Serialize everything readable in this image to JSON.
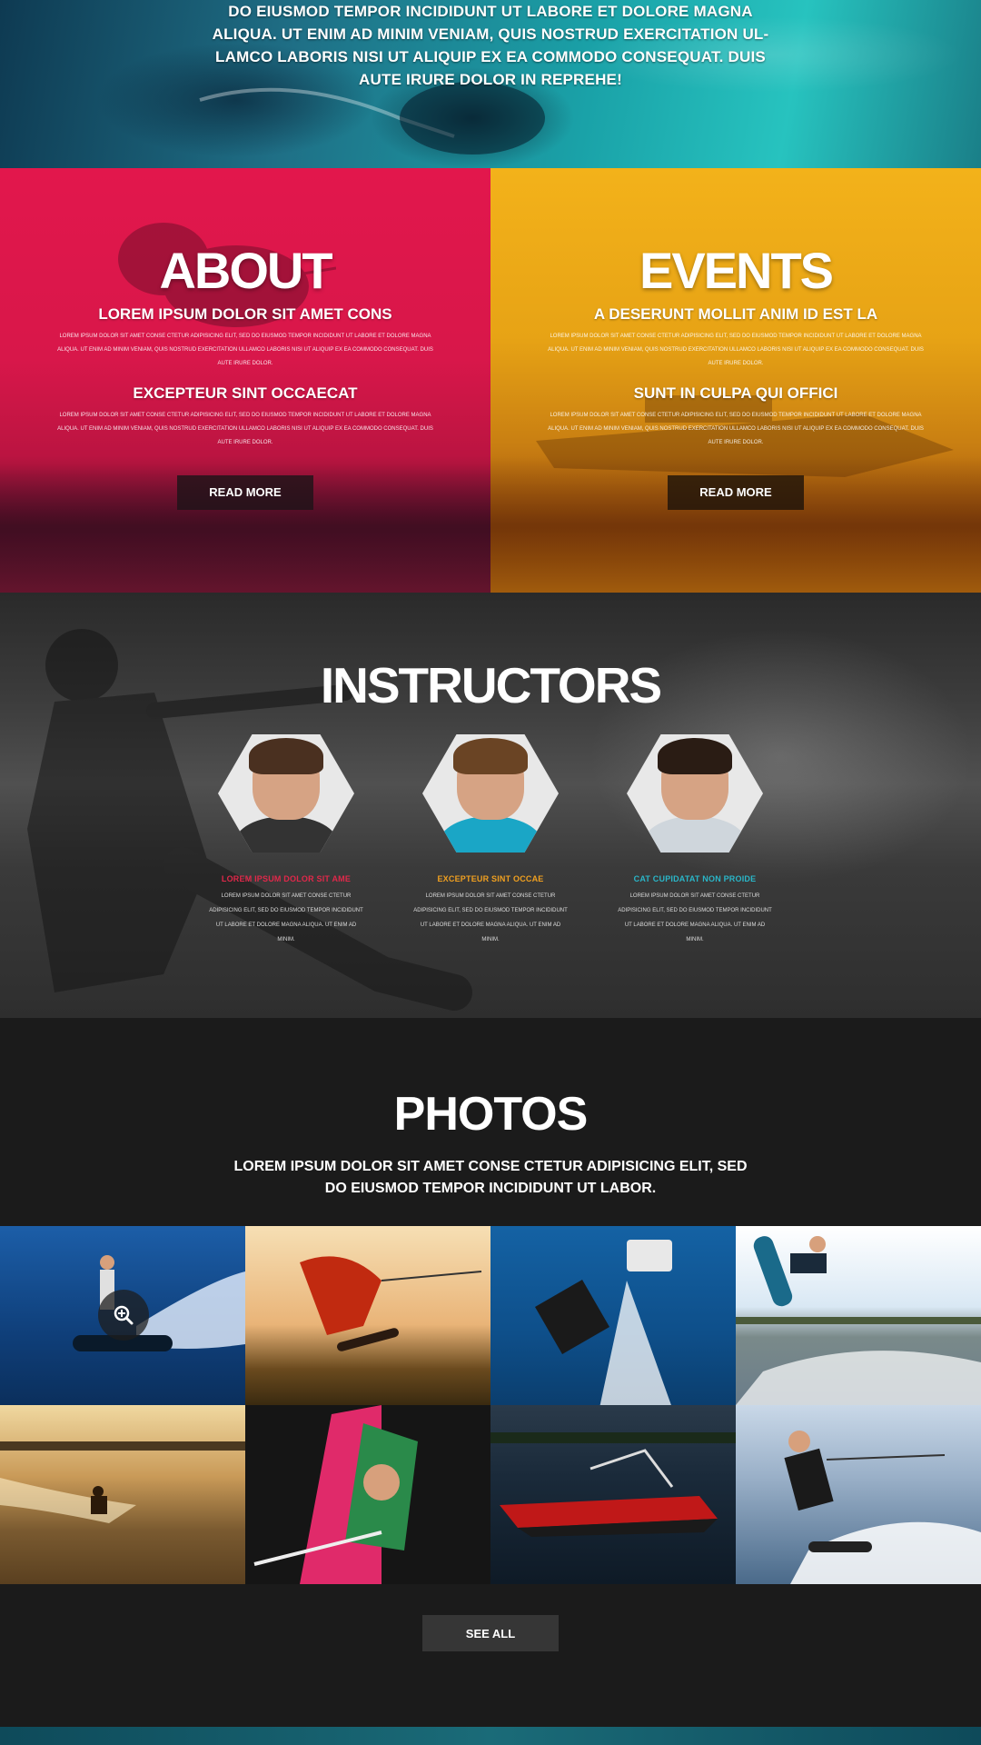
{
  "hero": {
    "lines": [
      "DO EIUSMOD TEMPOR INCIDIDUNT UT LABORE ET DOLORE MAGNA",
      "ALIQUA. UT ENIM AD MINIM VENIAM, QUIS NOSTRUD EXERCITATION UL-",
      "LAMCO LABORIS NISI UT ALIQUIP EX EA COMMODO CONSEQUAT. DUIS",
      "AUTE IRURE DOLOR IN REPREHE!"
    ]
  },
  "about": {
    "title": "ABOUT",
    "heading1": "LOREM IPSUM DOLOR SIT AMET CONS",
    "text1": "LOREM IPSUM DOLOR SIT AMET CONSE CTETUR ADIPISICING ELIT, SED DO EIUSMOD TEMPOR INCIDIDUNT UT LABORE ET DOLORE MAGNA ALIQUA. UT ENIM AD MINIM VENIAM, QUIS NOSTRUD EXERCITATION ULLAMCO LABORIS NISI UT ALIQUIP EX EA COMMODO CONSEQUAT. DUIS AUTE IRURE DOLOR.",
    "heading2": "EXCEPTEUR SINT OCCAECAT",
    "text2": "LOREM IPSUM DOLOR SIT AMET CONSE CTETUR ADIPISICING ELIT, SED DO EIUSMOD TEMPOR INCIDIDUNT UT LABORE ET DOLORE MAGNA ALIQUA. UT ENIM AD MINIM VENIAM, QUIS NOSTRUD EXERCITATION ULLAMCO LABORIS NISI UT ALIQUIP EX EA COMMODO CONSEQUAT. DUIS AUTE IRURE DOLOR.",
    "button": "READ MORE"
  },
  "events": {
    "title": "EVENTS",
    "heading1": "A DESERUNT MOLLIT ANIM ID EST LA",
    "text1": "LOREM IPSUM DOLOR SIT AMET CONSE CTETUR ADIPISICING ELIT, SED DO EIUSMOD TEMPOR INCIDIDUNT UT LABORE ET DOLORE MAGNA ALIQUA. UT ENIM AD MINIM VENIAM, QUIS NOSTRUD EXERCITATION ULLAMCO LABORIS NISI UT ALIQUIP EX EA COMMODO CONSEQUAT. DUIS AUTE IRURE DOLOR.",
    "heading2": "SUNT IN CULPA QUI OFFICI",
    "text2": "LOREM IPSUM DOLOR SIT AMET CONSE CTETUR ADIPISICING ELIT, SED DO EIUSMOD TEMPOR INCIDIDUNT UT LABORE ET DOLORE MAGNA ALIQUA. UT ENIM AD MINIM VENIAM, QUIS NOSTRUD EXERCITATION ULLAMCO LABORIS NISI UT ALIQUIP EX EA COMMODO CONSEQUAT. DUIS AUTE IRURE DOLOR.",
    "button": "READ MORE"
  },
  "instructors": {
    "title": "INSTRUCTORS",
    "people": [
      {
        "name": "LOREM IPSUM DOLOR SIT AME",
        "color": "#e0284a",
        "shirt": "#333333",
        "text": "LOREM IPSUM DOLOR SIT AMET CONSE CTETUR ADIPISICING ELIT, SED DO EIUSMOD TEMPOR INCIDIDUNT UT LABORE ET DOLORE MAGNA ALIQUA. UT ENIM AD MINIM."
      },
      {
        "name": "EXCEPTEUR SINT OCCAE",
        "color": "#f0a020",
        "shirt": "#1aa6c6",
        "text": "LOREM IPSUM DOLOR SIT AMET CONSE CTETUR ADIPISICING ELIT, SED DO EIUSMOD TEMPOR INCIDIDUNT UT LABORE ET DOLORE MAGNA ALIQUA. UT ENIM AD MINIM."
      },
      {
        "name": "CAT CUPIDATAT NON PROIDE",
        "color": "#2ab6c8",
        "shirt": "#cfd6dc",
        "text": "LOREM IPSUM DOLOR SIT AMET CONSE CTETUR ADIPISICING ELIT, SED DO EIUSMOD TEMPOR INCIDIDUNT UT LABORE ET DOLORE MAGNA ALIQUA. UT ENIM AD MINIM."
      }
    ]
  },
  "photos": {
    "title": "PHOTOS",
    "sub1": "LOREM IPSUM DOLOR SIT AMET CONSE CTETUR ADIPISICING ELIT, SED",
    "sub2": "DO EIUSMOD TEMPOR INCIDIDUNT UT LABOR.",
    "button": "SEE ALL",
    "zoom_icon": "zoom-in-icon"
  },
  "colors": {
    "about": "#e2174c",
    "events": "#f3b21a",
    "hero": "#1aa2a8",
    "dark": "#1b1b1b"
  }
}
